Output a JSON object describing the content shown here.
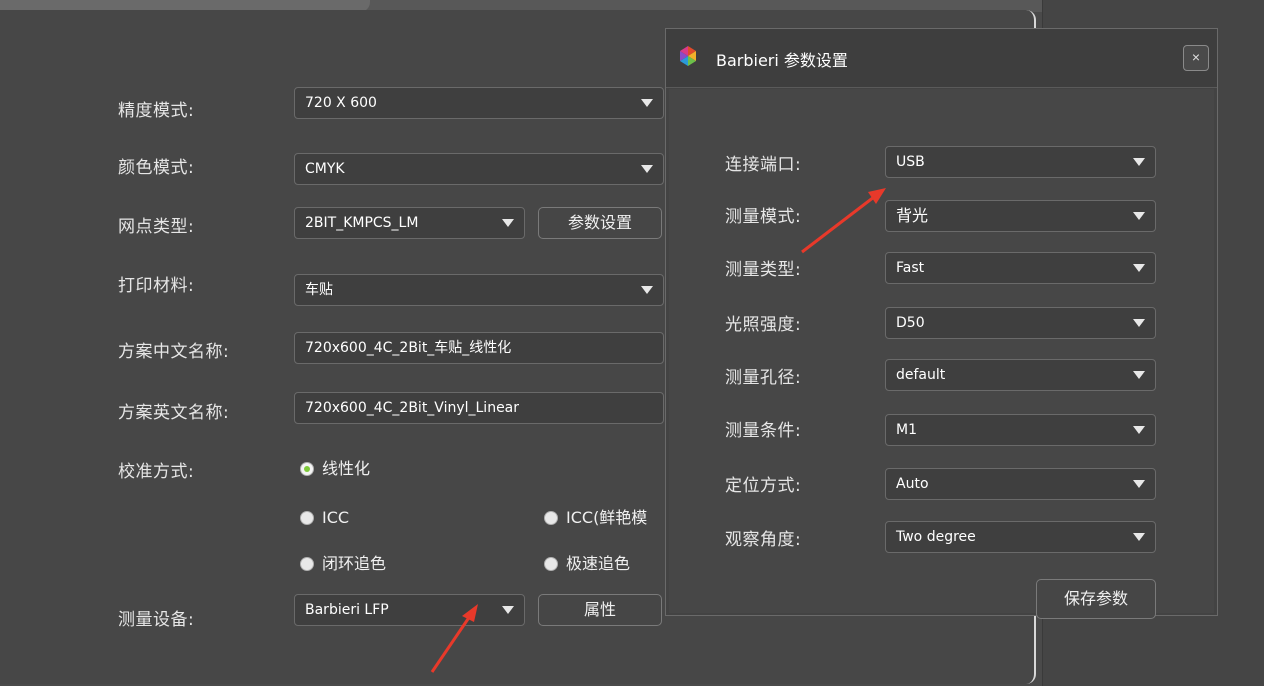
{
  "main": {
    "precision_label": "精度模式:",
    "precision_value": "720 X 600",
    "color_label": "颜色模式:",
    "color_value": "CMYK",
    "dot_label": "网点类型:",
    "dot_value": "2BIT_KMPCS_LM",
    "param_button": "参数设置",
    "material_label": "打印材料:",
    "material_value": "车贴",
    "cn_name_label": "方案中文名称:",
    "cn_name_value": "720x600_4C_2Bit_车贴_线性化",
    "en_name_label": "方案英文名称:",
    "en_name_value": "720x600_4C_2Bit_Vinyl_Linear",
    "calib_label": "校准方式:",
    "calib_options": [
      "线性化",
      "ICC",
      "ICC(鲜艳模",
      "闭环追色",
      "极速追色"
    ],
    "calib_selected": "线性化",
    "device_label": "测量设备:",
    "device_value": "Barbieri LFP",
    "prop_button": "属性"
  },
  "dialog": {
    "title": "Barbieri 参数设置",
    "close": "×",
    "rows": [
      {
        "label": "连接端口:",
        "value": "USB"
      },
      {
        "label": "测量模式:",
        "value": "背光"
      },
      {
        "label": "测量类型:",
        "value": "Fast"
      },
      {
        "label": "光照强度:",
        "value": "D50"
      },
      {
        "label": "测量孔径:",
        "value": "default"
      },
      {
        "label": "测量条件:",
        "value": "M1"
      },
      {
        "label": "定位方式:",
        "value": "Auto"
      },
      {
        "label": "观察角度:",
        "value": "Two degree"
      }
    ],
    "save_button": "保存参数"
  },
  "colors": {
    "annotation_arrow": "#e8392a",
    "radio_selected": "#7ec93a"
  }
}
